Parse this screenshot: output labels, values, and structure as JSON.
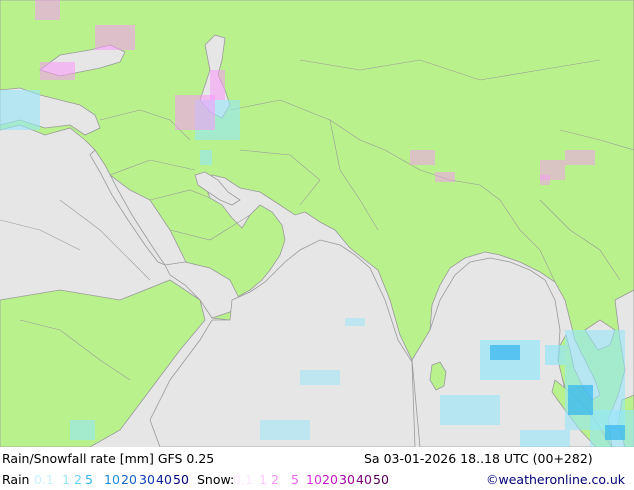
{
  "header": {
    "title": "Rain/Snowfall rate [mm] GFS 0.25",
    "datetime": "Sa 03-01-2026 18..18 UTC (00+282)"
  },
  "legend": {
    "rain_label": "Rain",
    "rain_scale": [
      "0.1",
      "1",
      "2",
      "5",
      "10",
      "20",
      "30",
      "40",
      "50"
    ],
    "rain_colors": [
      "#c8f0ff",
      "#96e6fa",
      "#64d2f5",
      "#32b4f0",
      "#1e8cdc",
      "#1464c8",
      "#0a3cb4",
      "#0a1e96",
      "#000078"
    ],
    "snow_label": "Snow:",
    "snow_scale": [
      "0.1",
      "1",
      "2",
      "5",
      "10",
      "20",
      "30",
      "40",
      "50"
    ],
    "snow_colors": [
      "#ffe6ff",
      "#ffc8ff",
      "#fa96fa",
      "#f064f0",
      "#dc32dc",
      "#c814c8",
      "#a000a0",
      "#780078",
      "#500050"
    ],
    "credit": "©weatheronline.co.uk"
  },
  "map_colors": {
    "land": "#b9f28c",
    "sea": "#e6e6e6",
    "border": "#9a9a9a",
    "text": "#000000",
    "credit": "#000078"
  }
}
